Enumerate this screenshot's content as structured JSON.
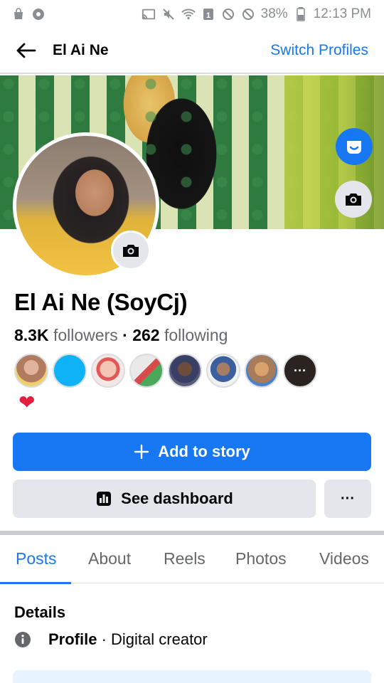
{
  "status_bar": {
    "battery": "38%",
    "time": "12:13 PM"
  },
  "header": {
    "title": "El Ai Ne",
    "switch_label": "Switch Profiles"
  },
  "profile": {
    "name": "El Ai Ne (SoyCj)",
    "followers_count": "8.3K",
    "followers_label": "followers",
    "separator": "·",
    "following_count": "262",
    "following_label": "following",
    "heart": "❤"
  },
  "actions": {
    "add_story_label": "Add to story",
    "dashboard_label": "See dashboard",
    "more_label": "···"
  },
  "tabs": [
    "Posts",
    "About",
    "Reels",
    "Photos",
    "Videos"
  ],
  "details": {
    "heading": "Details",
    "category_label": "Profile",
    "category_separator": " · ",
    "category_value": "Digital creator"
  },
  "colors": {
    "accent": "#1877f2",
    "secondary_bg": "#e4e6eb",
    "heart": "#e41e3f"
  }
}
